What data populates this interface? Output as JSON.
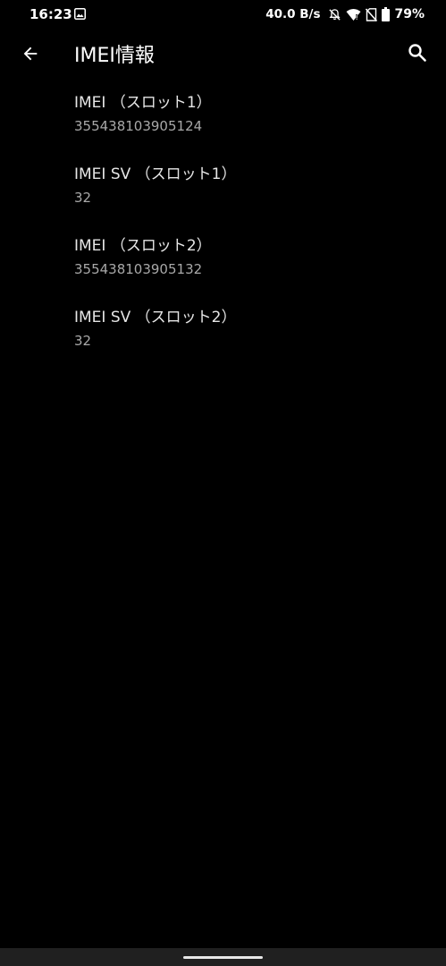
{
  "status_bar": {
    "time": "16:23",
    "net_speed": "40.0 B/s",
    "battery": "79%",
    "icons": [
      "image-icon",
      "bell-off-icon",
      "wifi-icon",
      "no-sim-icon",
      "battery-icon"
    ]
  },
  "toolbar": {
    "title": "IMEI情報",
    "back_icon": "arrow-back-icon",
    "search_icon": "search-icon"
  },
  "items": [
    {
      "title": "IMEI （スロット1）",
      "value": "355438103905124"
    },
    {
      "title": "IMEI SV （スロット1）",
      "value": "32"
    },
    {
      "title": "IMEI （スロット2）",
      "value": "355438103905132"
    },
    {
      "title": "IMEI SV （スロット2）",
      "value": "32"
    }
  ],
  "colors": {
    "background": "#000000",
    "title_text": "#e6e6e6",
    "value_text": "#a8a8a8",
    "nav_bar": "#202020"
  }
}
